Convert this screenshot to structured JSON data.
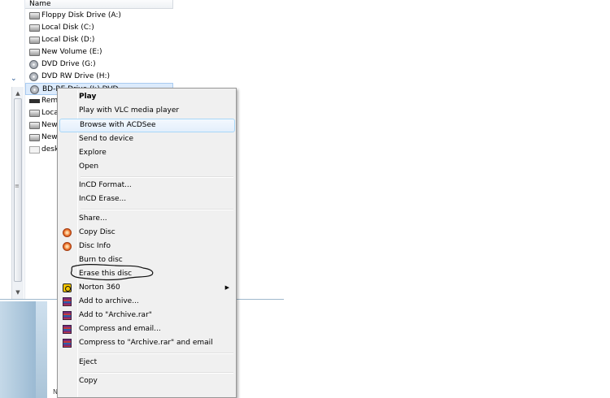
{
  "file_list": {
    "column_header": "Name",
    "items": [
      {
        "label": "Floppy Disk Drive (A:)",
        "icon": "drive-icon"
      },
      {
        "label": "Local Disk (C:)",
        "icon": "drive-icon"
      },
      {
        "label": "Local Disk (D:)",
        "icon": "drive-icon"
      },
      {
        "label": "New Volume (E:)",
        "icon": "drive-icon"
      },
      {
        "label": "DVD Drive (G:)",
        "icon": "disc-icon"
      },
      {
        "label": "DVD RW Drive (H:)",
        "icon": "disc-icon"
      },
      {
        "label": "BD-RE Drive (I:) DVD",
        "icon": "disc-icon",
        "selected": true
      },
      {
        "label": "Rem",
        "icon": "rem-icon"
      },
      {
        "label": "Loca",
        "icon": "drive-icon"
      },
      {
        "label": "New",
        "icon": "drive-icon"
      },
      {
        "label": "New",
        "icon": "drive-icon"
      },
      {
        "label": "desk",
        "icon": "desk-icon"
      }
    ]
  },
  "left_scroll": {
    "up": "▲",
    "down": "▼",
    "grip": "≡"
  },
  "nav_chevron": "⌄",
  "bottom_text": "N",
  "context_menu": {
    "items": [
      {
        "label": "Play",
        "bold": true
      },
      {
        "label": "Play with VLC media player"
      },
      {
        "label": "Browse with ACDSee",
        "hover": true
      },
      {
        "label": "Send to device"
      },
      {
        "label": "Explore"
      },
      {
        "label": "Open"
      },
      {
        "label": "InCD Format..."
      },
      {
        "label": "InCD Erase..."
      },
      {
        "label": "Share..."
      },
      {
        "label": "Copy Disc",
        "icon": "nero-icon"
      },
      {
        "label": "Disc Info",
        "icon": "nero-icon"
      },
      {
        "label": "Burn to disc"
      },
      {
        "label": "Erase this disc",
        "annotated": true
      },
      {
        "label": "Norton 360",
        "icon": "norton-icon",
        "submenu": "▶"
      },
      {
        "label": "Add to archive...",
        "icon": "rar-icon"
      },
      {
        "label": "Add to \"Archive.rar\"",
        "icon": "rar-icon"
      },
      {
        "label": "Compress and email...",
        "icon": "rar-icon"
      },
      {
        "label": "Compress to \"Archive.rar\" and email",
        "icon": "rar-icon"
      },
      {
        "label": "Eject"
      },
      {
        "label": "Copy"
      }
    ]
  }
}
